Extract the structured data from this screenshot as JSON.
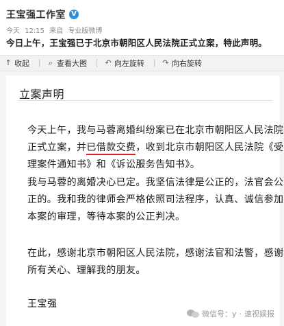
{
  "post": {
    "author": "王宝强工作室",
    "verified_badge": "V",
    "meta": {
      "date": "今天",
      "time": "12:15",
      "from": "来自",
      "client": "专业版微博"
    },
    "text": "今日上午，王宝强已于北京市朝阳区人民法院正式立案，特此声明。"
  },
  "toolbar": {
    "collapse_label": "收起",
    "view_large_label": "查看大图",
    "rotate_left_label": "向左旋转",
    "rotate_right_label": "向右旋转"
  },
  "document": {
    "title": "立案声明",
    "para1_line1": "今天上午，我与马蓉离婚纠纷案已在北京市朝阳区人民法院",
    "para1_line2_a": "正式立案，并",
    "para1_line2_b": "已借款交费",
    "para1_line2_c": "，收到北京市朝阳区人民法院《受",
    "para1_line3": "理案件通知书》和《诉讼服务告知书》。",
    "para2_line1": "我与马蓉的离婚决心已定。我坚信法律是公正的，法官会公",
    "para2_line2": "正的。我和我的律师会严格依照司法程序，认真、诚信参加",
    "para2_line3": "本案的审理，等待本案的公正判决。",
    "para3_line1": "在此，感谢北京市朝阳区人民法院，感谢法官和法警，感谢",
    "para3_line2": "所有关心、理解我的朋友。",
    "signature": "王宝强"
  },
  "watermark": {
    "prefix": "微信号",
    "account": "y",
    "separator": "·",
    "name": "速视娱报"
  },
  "colors": {
    "underline": "#d9202a",
    "verified": "#2b8fd9"
  }
}
